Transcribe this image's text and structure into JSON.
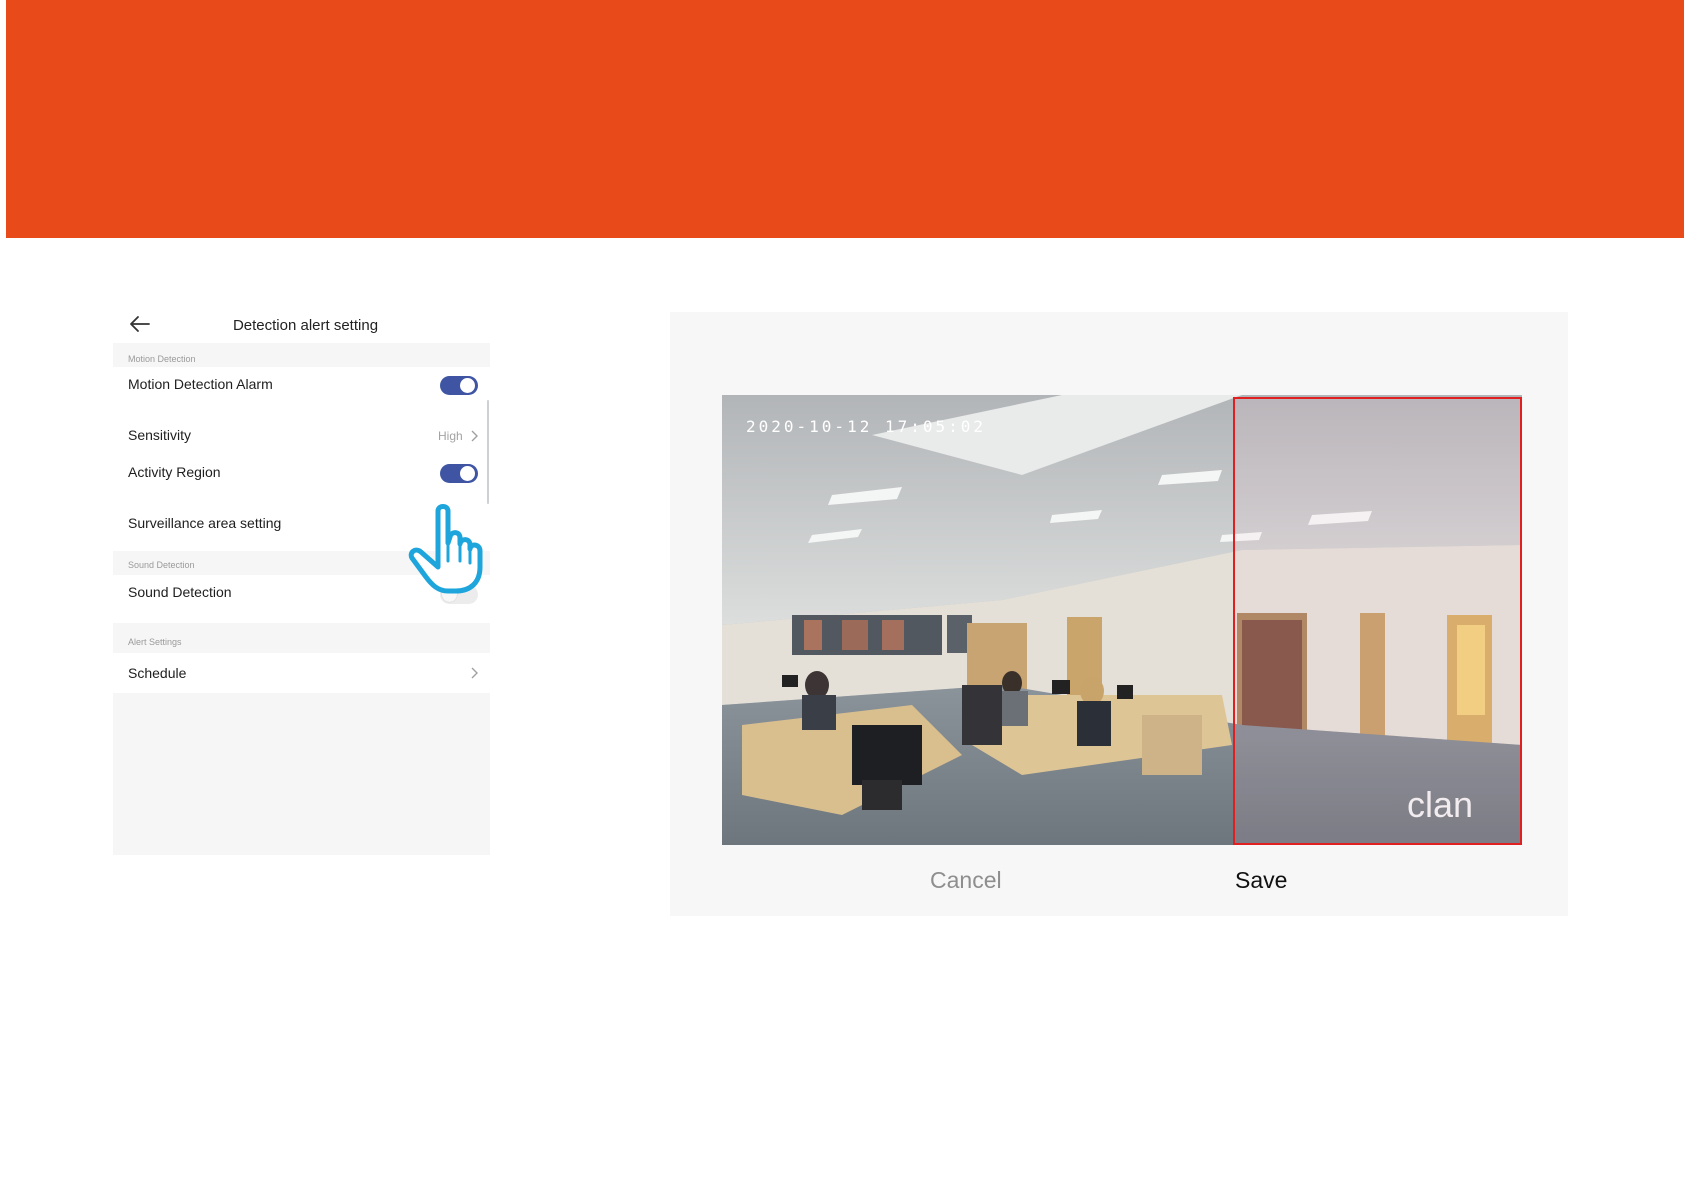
{
  "panel": {
    "title": "Detection alert setting",
    "sections": {
      "motion": "Motion Detection",
      "sound": "Sound Detection",
      "alert": "Alert Settings"
    },
    "rows": {
      "motion_alarm": {
        "label": "Motion Detection Alarm",
        "enabled": true
      },
      "sensitivity": {
        "label": "Sensitivity",
        "value": "High"
      },
      "activity_region": {
        "label": "Activity Region",
        "enabled": true
      },
      "surveillance_area": {
        "label": "Surveillance area setting"
      },
      "sound_detection": {
        "label": "Sound Detection",
        "enabled": false
      },
      "schedule": {
        "label": "Schedule"
      }
    }
  },
  "dialog": {
    "camera": {
      "timestamp": "2020-10-12 17:05:02",
      "watermark": "clan"
    },
    "cancel_label": "Cancel",
    "save_label": "Save"
  },
  "colors": {
    "banner": "#e84a1a",
    "toggle_on": "#3f55a3",
    "region_border": "#e02020",
    "hand_icon": "#1ea5dc"
  },
  "icons": {
    "back": "arrow-left-icon",
    "chevron": "chevron-right-icon",
    "pointer": "hand-pointer-icon"
  }
}
